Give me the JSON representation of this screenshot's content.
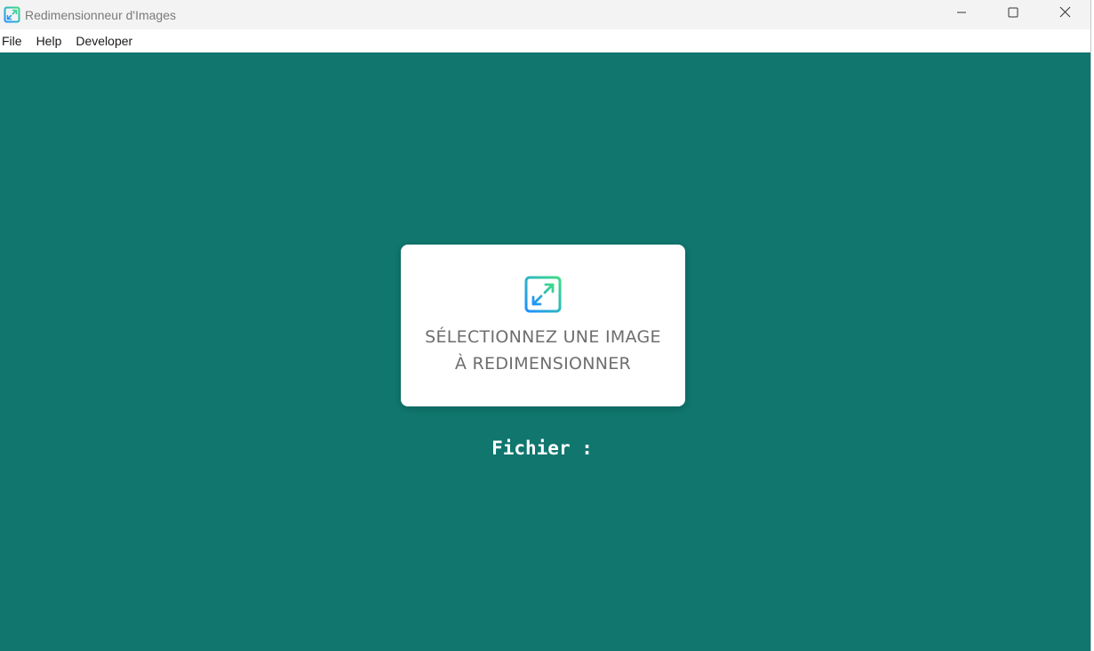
{
  "window": {
    "title": "Redimensionneur d'Images",
    "app_icon": "resize-arrows-icon",
    "controls": {
      "minimize_icon": "minimize-icon",
      "maximize_icon": "maximize-icon",
      "close_icon": "close-icon"
    }
  },
  "menu": {
    "items": [
      {
        "label": "File"
      },
      {
        "label": "Help"
      },
      {
        "label": "Developer"
      }
    ]
  },
  "main": {
    "background_color": "#10766e",
    "dropzone": {
      "icon": "resize-arrows-icon",
      "line1": "SÉLECTIONNEZ UNE IMAGE",
      "line2": "À REDIMENSIONNER"
    },
    "file_label": "Fichier :"
  },
  "colors": {
    "accent_gradient_start": "#3ddc84",
    "accent_gradient_end": "#1e90ff",
    "card_text": "#6e6e6e"
  }
}
